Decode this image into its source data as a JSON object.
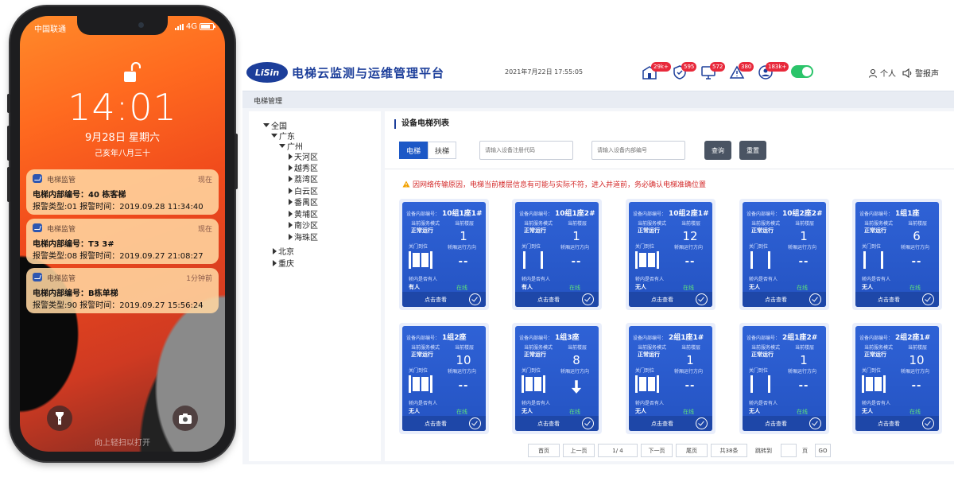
{
  "phone": {
    "carrier": "中国联通",
    "network": "4G",
    "time": "14:01",
    "date": "9月28日 星期六",
    "lunar": "己亥年八月三十",
    "swipe_hint": "向上轻扫以打开",
    "notifications": [
      {
        "app": "电梯监管",
        "time": "现在",
        "line1": "电梯内部编号：40 栋客梯",
        "line2": "报警类型:01 报警时间：2019.09.28 11:34:40"
      },
      {
        "app": "电梯监管",
        "time": "现在",
        "line1": "电梯内部编号：T3 3#",
        "line2": "报警类型:08 报警时间：2019.09.27 21:08:27"
      },
      {
        "app": "电梯监管",
        "time": "1分钟前",
        "line1": "电梯内部编号：B栋单梯",
        "line2": "报警类型:90 报警时间：2019.09.27 15:56:24"
      }
    ],
    "icons": {
      "flashlight": "flashlight-icon",
      "camera": "camera-icon",
      "lock": "unlocked-padlock-icon"
    }
  },
  "header": {
    "logo": "LiSin",
    "title": "电梯云监测与运维管理平台",
    "datetime": "2021年7月22日 17:55:05",
    "badges": [
      "29k+",
      "595",
      "572",
      "380",
      "183k+"
    ],
    "user_label": "个人",
    "alarm_label": "警报声",
    "accent": "#1c3e9a",
    "badge_color": "#e8293b"
  },
  "breadcrumb": "电梯管理",
  "tree": {
    "root": "全国",
    "province": "广东",
    "city": "广州",
    "districts": [
      "天河区",
      "越秀区",
      "荔湾区",
      "白云区",
      "番禺区",
      "黄埔区",
      "南沙区",
      "海珠区"
    ],
    "others": [
      "北京",
      "重庆"
    ]
  },
  "main": {
    "title": "设备电梯列表",
    "tabs": [
      "电梯",
      "扶梯"
    ],
    "reg_placeholder": "请输入设备注册代码",
    "inner_placeholder": "请输入设备内部编号",
    "query_label": "查询",
    "reset_label": "重置",
    "warning": "因网络传输原因，电梯当前楼层信息有可能与实际不符，进入井道前，务必确认电梯准确位置"
  },
  "card_labels": {
    "device_no": "设备内部编号：",
    "service_mode": "当前服务模式",
    "current_floor": "当前楼层",
    "door": "关门到位",
    "direction": "轿厢运行方向",
    "occupancy": "轿内是否有人",
    "view": "点击查看"
  },
  "cards": [
    {
      "name": "10组1座1#",
      "mode": "正常运行",
      "floor": "1",
      "direction": "--",
      "people": "有人",
      "status": "在线"
    },
    {
      "name": "10组1座2#",
      "mode": "正常运行",
      "floor": "1",
      "direction": "--",
      "people": "有人",
      "status": "在线"
    },
    {
      "name": "10组2座1#",
      "mode": "正常运行",
      "floor": "12",
      "direction": "--",
      "people": "无人",
      "status": "在线"
    },
    {
      "name": "10组2座2#",
      "mode": "正常运行",
      "floor": "1",
      "direction": "--",
      "people": "无人",
      "status": "在线"
    },
    {
      "name": "1组1座",
      "mode": "正常运行",
      "floor": "6",
      "direction": "--",
      "people": "无人",
      "status": "在线"
    },
    {
      "name": "1组2座",
      "mode": "正常运行",
      "floor": "10",
      "direction": "--",
      "people": "无人",
      "status": "在线"
    },
    {
      "name": "1组3座",
      "mode": "正常运行",
      "floor": "8",
      "direction": "down-arrow",
      "people": "无人",
      "status": "在线"
    },
    {
      "name": "2组1座1#",
      "mode": "正常运行",
      "floor": "1",
      "direction": "--",
      "people": "无人",
      "status": "在线"
    },
    {
      "name": "2组1座2#",
      "mode": "正常运行",
      "floor": "1",
      "direction": "--",
      "people": "无人",
      "status": "在线"
    },
    {
      "name": "2组2座1#",
      "mode": "正常运行",
      "floor": "10",
      "direction": "--",
      "people": "无人",
      "status": "在线"
    }
  ],
  "pagination": {
    "first": "首页",
    "prev": "上一页",
    "current": "1/ 4",
    "next": "下一页",
    "last": "尾页",
    "total": "共38条",
    "jump_label": "跳转到",
    "page_unit": "页",
    "go": "GO"
  }
}
